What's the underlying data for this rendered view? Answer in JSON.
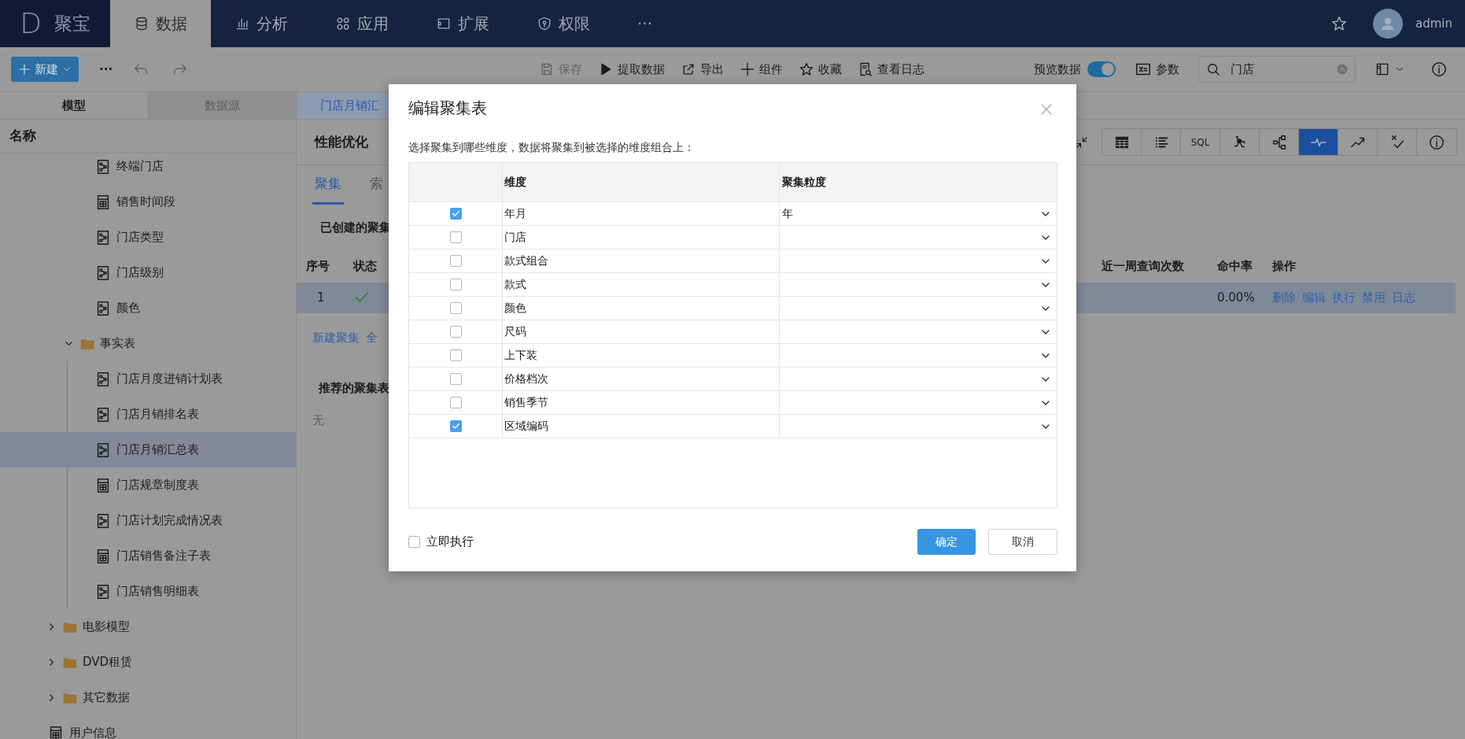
{
  "app": {
    "logo": "D",
    "name": "聚宝"
  },
  "nav_tabs": [
    {
      "kind": "database",
      "label": "数据",
      "selected": true
    },
    {
      "kind": "chart",
      "label": "分析",
      "selected": false
    },
    {
      "kind": "apps",
      "label": "应用",
      "selected": false
    },
    {
      "kind": "extension",
      "label": "扩展",
      "selected": false
    },
    {
      "kind": "shield",
      "label": "权限",
      "selected": false
    }
  ],
  "nav_more": "···",
  "user": {
    "name": "admin"
  },
  "toolbar": {
    "new_button": "新建",
    "more": "···",
    "history": [
      {
        "kind": "undo",
        "disabled": true
      },
      {
        "kind": "redo",
        "disabled": true
      }
    ],
    "actions": [
      {
        "kind": "save",
        "label": "保存",
        "disabled": true
      },
      {
        "kind": "extract",
        "label": "提取数据",
        "disabled": false
      },
      {
        "kind": "export",
        "label": "导出",
        "disabled": false
      },
      {
        "kind": "component",
        "label": "组件",
        "disabled": false
      },
      {
        "kind": "favorite",
        "label": "收藏",
        "disabled": false
      },
      {
        "kind": "log",
        "label": "查看日志",
        "disabled": false
      }
    ],
    "preview": {
      "label": "预览数据",
      "on": true
    },
    "params": {
      "label": "参数"
    },
    "search": {
      "value": "门店"
    }
  },
  "sidebar": {
    "tabs": [
      {
        "label": "模型",
        "selected": true
      },
      {
        "label": "数据源",
        "selected": false
      }
    ],
    "header": "名称",
    "tree": [
      {
        "children": [
          {
            "children": [
              {
                "kind": "model",
                "label": "终端门店",
                "selected": false
              },
              {
                "kind": "table",
                "label": "销售时间段",
                "selected": false
              },
              {
                "kind": "model",
                "label": "门店类型",
                "selected": false
              },
              {
                "kind": "model",
                "label": "门店级别",
                "selected": false
              },
              {
                "kind": "model",
                "label": "颜色",
                "selected": false
              }
            ]
          },
          {
            "kind": "folder",
            "label": "事实表",
            "expanded": true,
            "selected": false,
            "children": [
              {
                "kind": "model",
                "label": "门店月度进销计划表",
                "selected": false
              },
              {
                "kind": "model",
                "label": "门店月销排名表",
                "selected": false
              },
              {
                "kind": "model",
                "label": "门店月销汇总表",
                "selected": true
              },
              {
                "kind": "table",
                "label": "门店规章制度表",
                "selected": false
              },
              {
                "kind": "model",
                "label": "门店计划完成情况表",
                "selected": false
              },
              {
                "kind": "table",
                "label": "门店销售备注子表",
                "selected": false
              },
              {
                "kind": "model",
                "label": "门店销售明细表",
                "selected": false
              }
            ]
          }
        ]
      },
      {
        "kind": "folder",
        "label": "电影模型",
        "expanded": false,
        "selected": false
      },
      {
        "kind": "folder",
        "label": "DVD租赁",
        "expanded": false,
        "selected": false
      },
      {
        "kind": "folder",
        "label": "其它数据",
        "expanded": false,
        "selected": false
      },
      {
        "kind": "table",
        "label": "用户信息",
        "selected": false
      }
    ]
  },
  "main": {
    "doc_tab": "门店月销汇",
    "title": "性能优化",
    "view_buttons": [
      {
        "kind": "table",
        "selected": false
      },
      {
        "kind": "list",
        "selected": false
      },
      {
        "kind": "sql",
        "label": "SQL",
        "selected": false
      },
      {
        "kind": "graph",
        "selected": false
      },
      {
        "kind": "tree",
        "selected": false
      },
      {
        "kind": "pulse",
        "selected": true
      },
      {
        "kind": "trend",
        "selected": false
      },
      {
        "kind": "check",
        "selected": false
      },
      {
        "kind": "info",
        "selected": false
      }
    ],
    "tabs": [
      {
        "label": "聚集",
        "selected": true
      },
      {
        "label": "索",
        "selected": false
      }
    ],
    "created_heading": "已创建的聚集",
    "columns_left": [
      "序号",
      "状态"
    ],
    "columns_right": [
      "近一周查询次数",
      "命中率",
      "操作"
    ],
    "rows": [
      {
        "index": "1",
        "succeeded": true,
        "hit_rate": "0.00%",
        "actions": [
          "删除",
          "编辑",
          "执行",
          "禁用",
          "日志"
        ],
        "selected": true
      }
    ],
    "links": [
      "新建聚集",
      "全"
    ],
    "recommended_heading": "推荐的聚集表",
    "recommended_empty": "无"
  },
  "dialog": {
    "title": "编辑聚集表",
    "description": "选择聚集到哪些维度，数据将聚集到被选择的维度组合上：",
    "columns": [
      "维度",
      "聚集粒度"
    ],
    "rows": [
      {
        "dimension": "年月",
        "checked": true,
        "granularity": "年"
      },
      {
        "dimension": "门店",
        "checked": false
      },
      {
        "dimension": "款式组合",
        "checked": false
      },
      {
        "dimension": "款式",
        "checked": false
      },
      {
        "dimension": "颜色",
        "checked": false
      },
      {
        "dimension": "尺码",
        "checked": false
      },
      {
        "dimension": "上下装",
        "checked": false
      },
      {
        "dimension": "价格档次",
        "checked": false
      },
      {
        "dimension": "销售季节",
        "checked": false
      },
      {
        "dimension": "区域编码",
        "checked": true
      }
    ],
    "run_now": {
      "label": "立即执行",
      "checked": false
    },
    "buttons": [
      {
        "kind": "primary",
        "label": "确定"
      },
      {
        "kind": "secondary",
        "label": "取消"
      }
    ]
  }
}
